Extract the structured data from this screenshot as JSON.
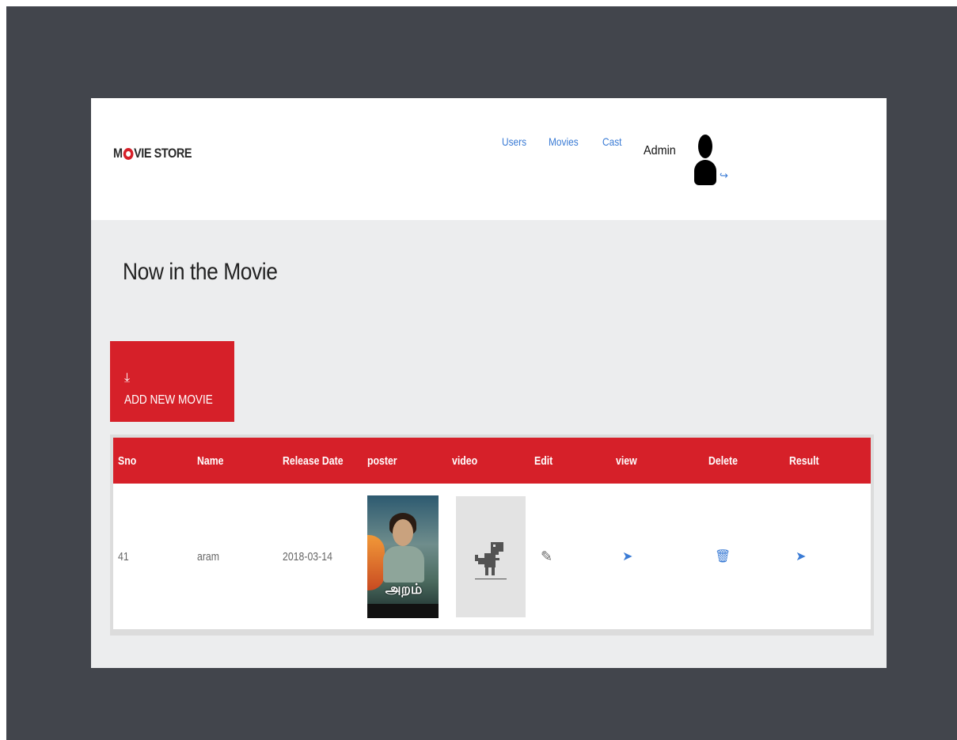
{
  "navbar": {
    "brand_pre": "M",
    "brand_post": "VIE STORE",
    "links": [
      "Users",
      "Movies",
      "Cast"
    ],
    "user_label": "Admin"
  },
  "page": {
    "title": "Now in the Movie",
    "add_button_label": "ADD NEW MOVIE"
  },
  "table": {
    "headers": [
      "Sno",
      "Name",
      "Release Date",
      "poster",
      "video",
      "Edit",
      "view",
      "Delete",
      "Result"
    ],
    "rows": [
      {
        "sno": "41",
        "name": "aram",
        "release_date": "2018-03-14"
      }
    ]
  },
  "icons": {
    "download": "download-icon",
    "logout": "logout-icon",
    "edit": "pencil-icon",
    "view": "send-icon",
    "delete": "trash-icon",
    "result": "send-icon"
  },
  "colors": {
    "accent": "#d62029",
    "link": "#3a7bd5",
    "backdrop": "#42454c"
  }
}
